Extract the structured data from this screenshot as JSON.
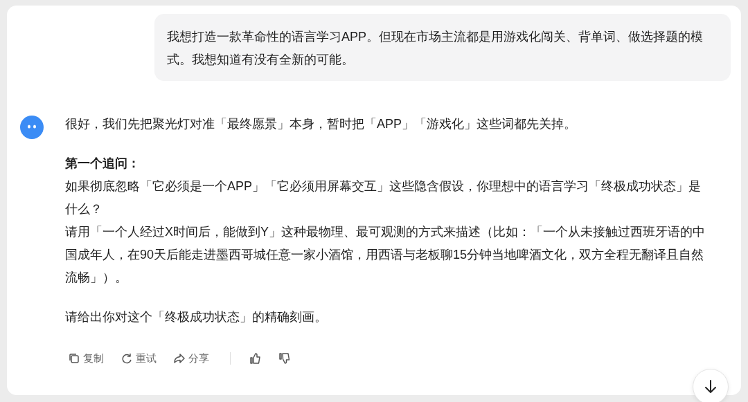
{
  "user_message": "我想打造一款革命性的语言学习APP。但现在市场主流都是用游戏化闯关、背单词、做选择题的模式。我想知道有没有全新的可能。",
  "assistant": {
    "intro": "很好，我们先把聚光灯对准「最终愿景」本身，暂时把「APP」「游戏化」这些词都先关掉。",
    "heading": "第一个追问：",
    "question_lines": [
      "如果彻底忽略「它必须是一个APP」「它必须用屏幕交互」这些隐含假设，你理想中的语言学习「终极成功状态」是什么？",
      "请用「一个人经过X时间后，能做到Y」这种最物理、最可观测的方式来描述（比如：「一个从未接触过西班牙语的中国成年人，在90天后能走进墨西哥城任意一家小酒馆，用西语与老板聊15分钟当地啤酒文化，双方全程无翻译且自然流畅」）。"
    ],
    "closing": "请给出你对这个「终极成功状态」的精确刻画。"
  },
  "actions": [
    {
      "kind": "copy",
      "label": "复制"
    },
    {
      "kind": "retry",
      "label": "重试"
    },
    {
      "kind": "share",
      "label": "分享"
    },
    {
      "kind": "like"
    },
    {
      "kind": "dislike"
    }
  ]
}
